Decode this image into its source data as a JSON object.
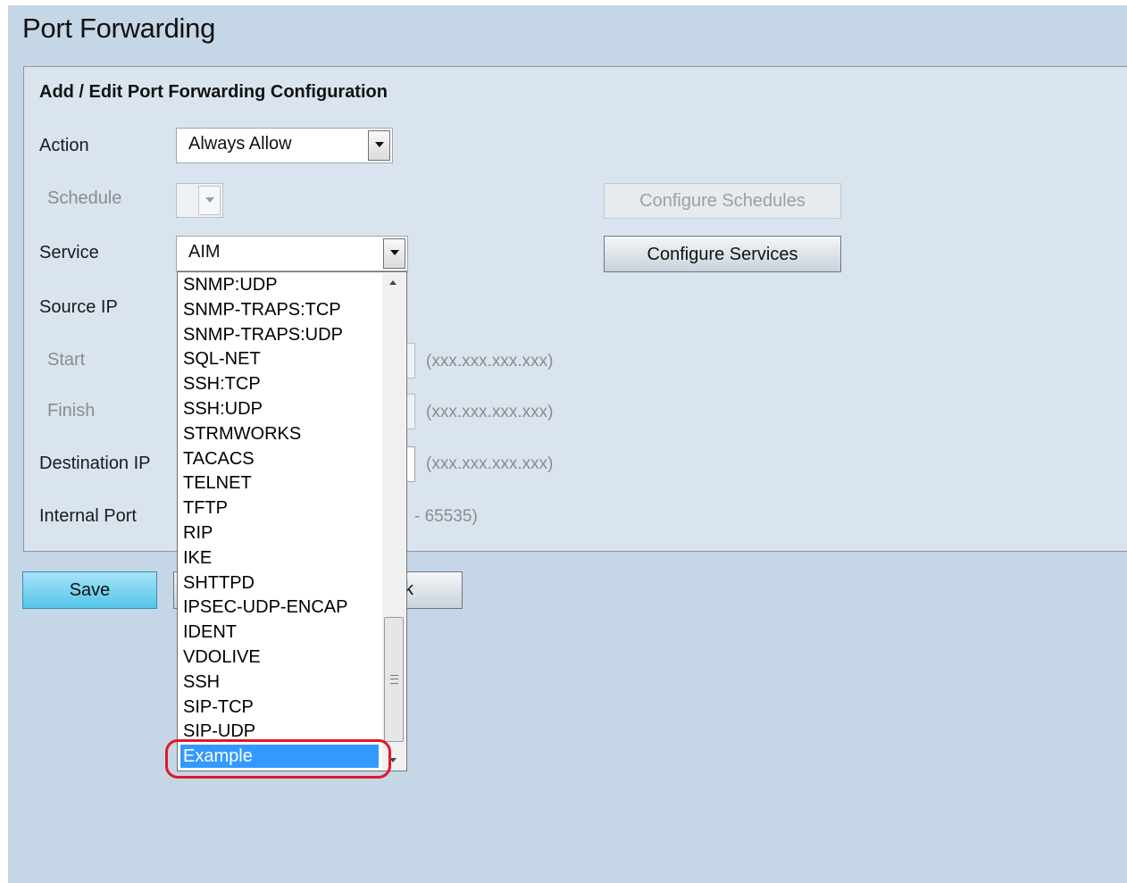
{
  "page": {
    "title": "Port Forwarding"
  },
  "panel": {
    "title": "Add / Edit Port Forwarding Configuration"
  },
  "form": {
    "action": {
      "label": "Action",
      "value": "Always Allow"
    },
    "schedule": {
      "label": "Schedule",
      "value": "",
      "button": "Configure Schedules"
    },
    "service": {
      "label": "Service",
      "value": "AIM",
      "button": "Configure Services"
    },
    "source_ip": {
      "label": "Source IP"
    },
    "start": {
      "label": "Start",
      "hint": "(xxx.xxx.xxx.xxx)"
    },
    "finish": {
      "label": "Finish",
      "hint": "(xxx.xxx.xxx.xxx)"
    },
    "destination_ip": {
      "label": "Destination IP",
      "hint": "(xxx.xxx.xxx.xxx)"
    },
    "internal_port": {
      "label": "Internal Port",
      "hint": "- 65535)"
    }
  },
  "buttons": {
    "save": "Save",
    "back_partial": "k"
  },
  "service_dropdown": {
    "options": [
      "SNMP:UDP",
      "SNMP-TRAPS:TCP",
      "SNMP-TRAPS:UDP",
      "SQL-NET",
      "SSH:TCP",
      "SSH:UDP",
      "STRMWORKS",
      "TACACS",
      "TELNET",
      "TFTP",
      "RIP",
      "IKE",
      "SHTTPD",
      "IPSEC-UDP-ENCAP",
      "IDENT",
      "VDOLIVE",
      "SSH",
      "SIP-TCP",
      "SIP-UDP",
      "Example"
    ],
    "selected": "Example"
  },
  "colors": {
    "highlight": "#3399ff",
    "annotation": "#e0182a",
    "save_button": "#54c5ea"
  }
}
